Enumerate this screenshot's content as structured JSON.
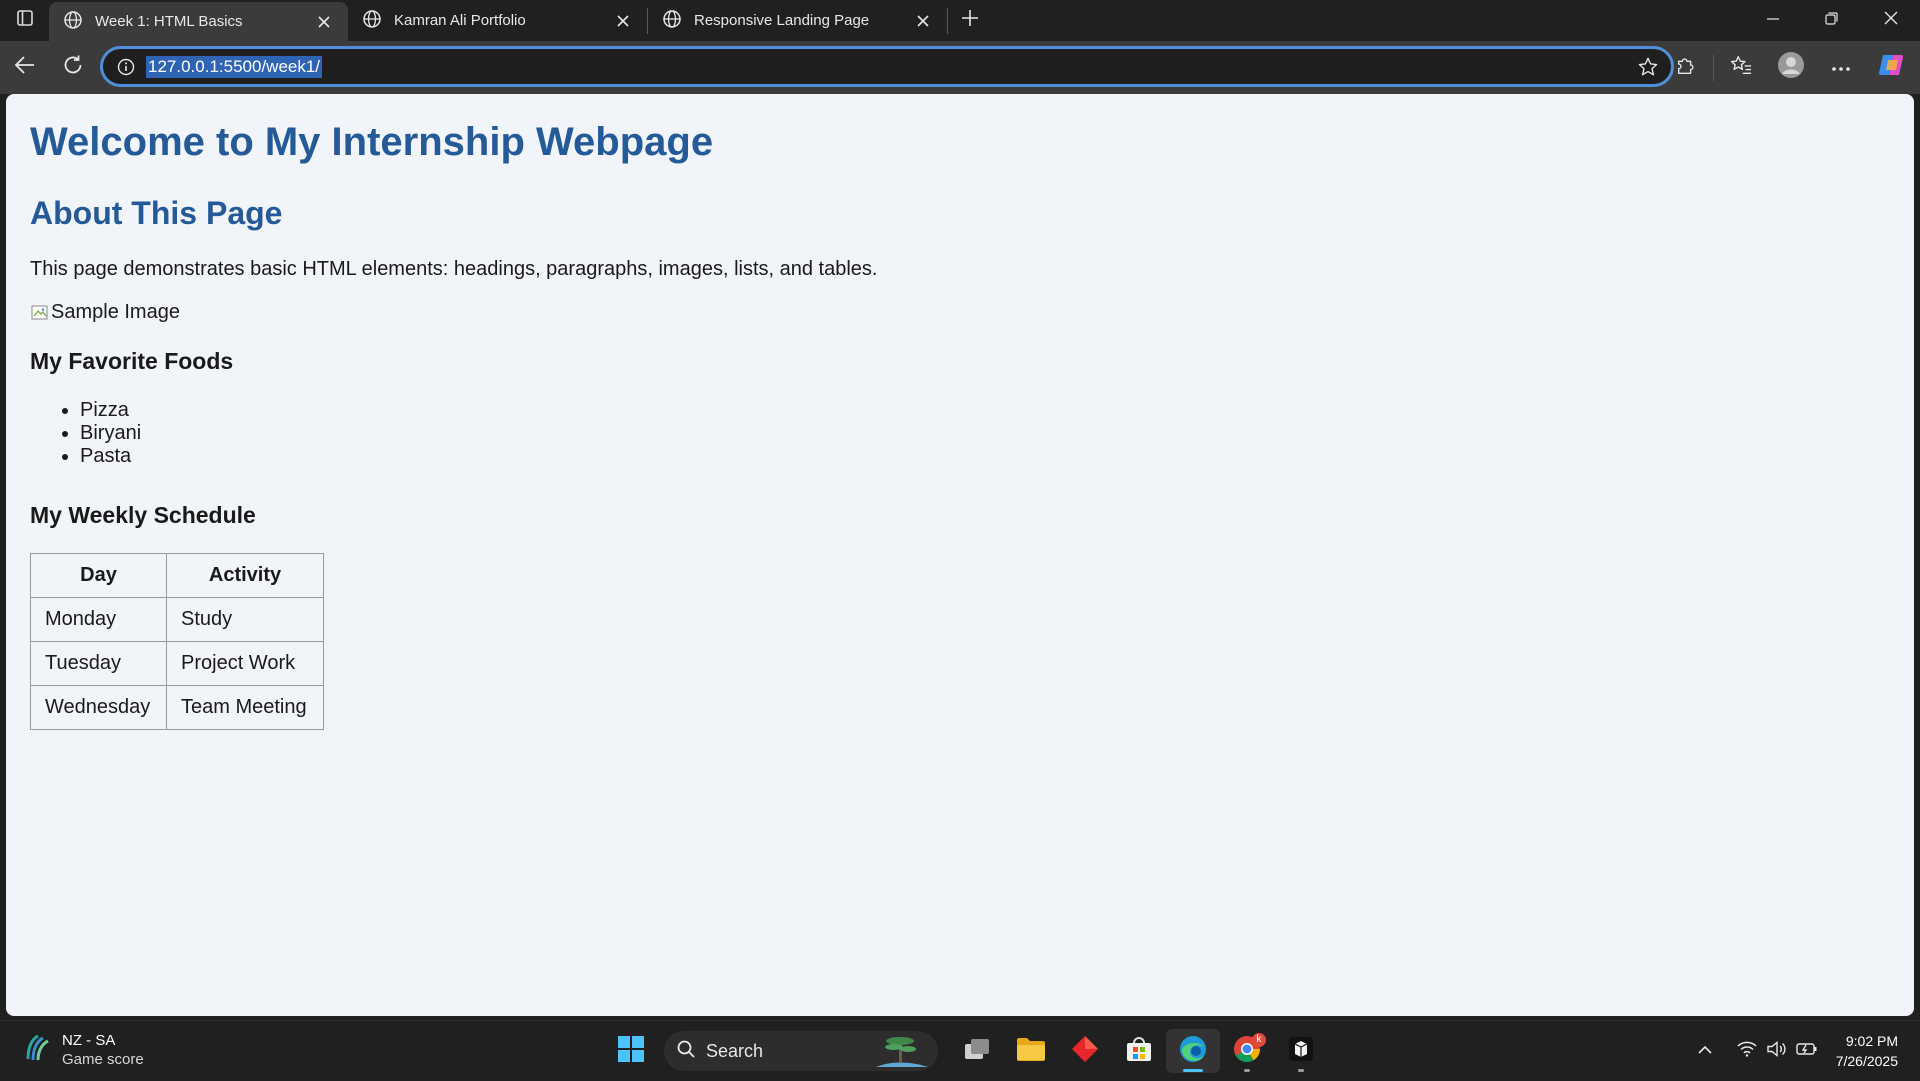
{
  "browser": {
    "tabs": [
      {
        "title": "Week 1: HTML Basics",
        "active": true
      },
      {
        "title": "Kamran Ali Portfolio",
        "active": false
      },
      {
        "title": "Responsive Landing Page",
        "active": false
      }
    ],
    "address": {
      "url": "127.0.0.1:5500/week1/"
    }
  },
  "page": {
    "h1": "Welcome to My Internship Webpage",
    "about_heading": "About This Page",
    "about_text": "This page demonstrates basic HTML elements: headings, paragraphs, images, lists, and tables.",
    "image_alt": "Sample Image",
    "foods_heading": "My Favorite Foods",
    "foods": [
      "Pizza",
      "Biryani",
      "Pasta"
    ],
    "schedule_heading": "My Weekly Schedule",
    "schedule": {
      "headers": [
        "Day",
        "Activity"
      ],
      "rows": [
        [
          "Monday",
          "Study"
        ],
        [
          "Tuesday",
          "Project Work"
        ],
        [
          "Wednesday",
          "Team Meeting"
        ]
      ]
    }
  },
  "taskbar": {
    "widget": {
      "title": "NZ - SA",
      "subtitle": "Game score"
    },
    "search_label": "Search",
    "clock": {
      "time": "9:02 PM",
      "date": "7/26/2025"
    },
    "notification_badge": "k"
  },
  "colors": {
    "heading": "#255a99",
    "accent": "#4f8fd8",
    "page_bg": "#f1f4f8"
  }
}
